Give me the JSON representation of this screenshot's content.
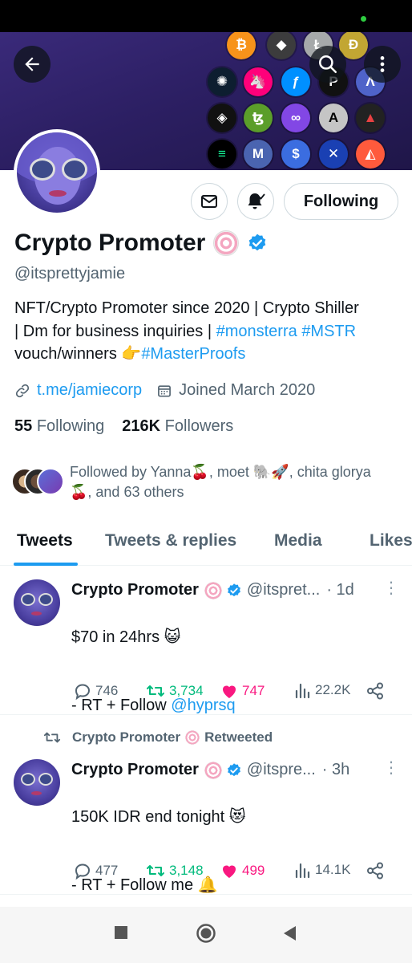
{
  "colors": {
    "accent": "#1d9bf0",
    "text": "#0f1419",
    "muted": "#536471",
    "retweet": "#00ba7c",
    "like": "#f91880"
  },
  "header": {
    "back_icon": "arrow-left-icon",
    "search_icon": "search-icon",
    "more_icon": "vertical-dots-icon"
  },
  "profile": {
    "name": "Crypto Promoter",
    "handle": "@itsprettyjamie",
    "bio_line1": "NFT/Crypto Promoter since 2020 | Crypto Shiller",
    "bio_line2a": "| Dm for business inquiries | ",
    "bio_tag1": "#monsterra",
    "bio_tag2": "#MSTR",
    "bio_line3a": "vouch/winners 👉",
    "bio_tag3": "#MasterProofs",
    "link": "t.me/jamiecorp",
    "joined": "Joined March 2020",
    "following_count": "55",
    "following_label": "Following",
    "followers_count": "216K",
    "followers_label": "Followers",
    "follow_button": "Following",
    "followed_by_line1": "Followed by Yanna🍒, moet 🐘🚀, chita glorya",
    "followed_by_line2": "🍒, and 63 others"
  },
  "tabs": [
    {
      "label": "Tweets"
    },
    {
      "label": "Tweets & replies"
    },
    {
      "label": "Media"
    },
    {
      "label": "Likes"
    }
  ],
  "tweets": [
    {
      "name": "Crypto Promoter",
      "handle": "@itspret...",
      "time": "· 1d",
      "line1": "$70  in 24hrs 😺",
      "line2_prefix": "- RT + Follow ",
      "line2_link": "@hyprsq",
      "replies": "746",
      "retweets": "3,734",
      "likes": "747",
      "views": "22.2K"
    },
    {
      "retweeted_by": "Crypto Promoter",
      "retweeted_label": "Retweeted",
      "name": "Crypto Promoter",
      "handle": "@itspre...",
      "time": "· 3h",
      "line1": "150K IDR end tonight 😻",
      "line2_prefix": "- RT + Follow me 🔔",
      "replies": "477",
      "retweets": "3,148",
      "likes": "499",
      "views": "14.1K"
    }
  ]
}
